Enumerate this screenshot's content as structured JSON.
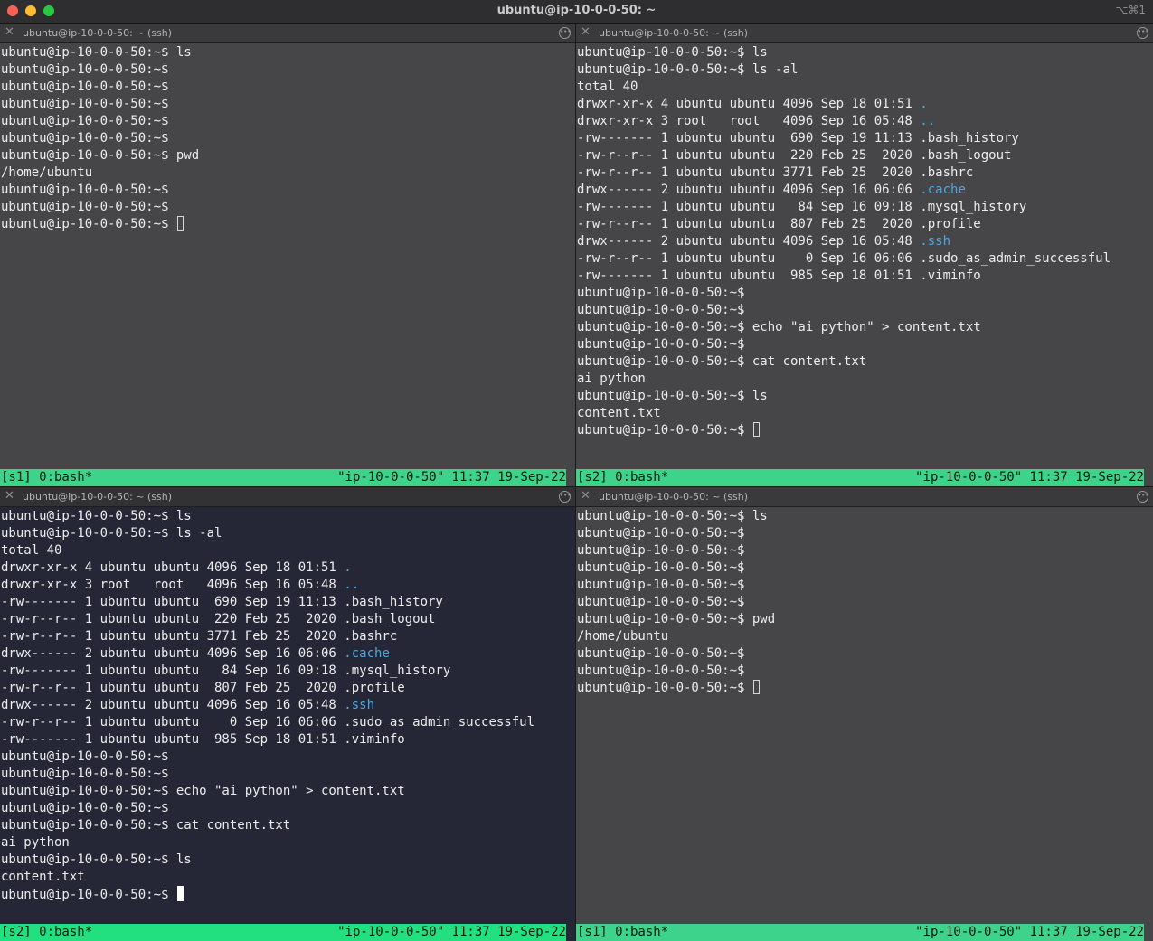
{
  "window": {
    "title": "ubuntu@ip-10-0-0-50: ~",
    "shortcut": "⌥⌘1"
  },
  "panes": [
    {
      "tab_title": "ubuntu@ip-10-0-0-50: ~ (ssh)",
      "active": false,
      "cursor": "box",
      "lines": [
        "ubuntu@ip-10-0-0-50:~$ ls",
        "ubuntu@ip-10-0-0-50:~$",
        "ubuntu@ip-10-0-0-50:~$",
        "ubuntu@ip-10-0-0-50:~$",
        "ubuntu@ip-10-0-0-50:~$",
        "ubuntu@ip-10-0-0-50:~$",
        "ubuntu@ip-10-0-0-50:~$ pwd",
        "/home/ubuntu",
        "ubuntu@ip-10-0-0-50:~$",
        "ubuntu@ip-10-0-0-50:~$",
        "ubuntu@ip-10-0-0-50:~$ "
      ],
      "status_left": "[s1] 0:bash*",
      "status_right": "\"ip-10-0-0-50\" 11:37 19-Sep-22"
    },
    {
      "tab_title": "ubuntu@ip-10-0-0-50: ~ (ssh)",
      "active": false,
      "cursor": "box",
      "lines": [
        "ubuntu@ip-10-0-0-50:~$ ls",
        "ubuntu@ip-10-0-0-50:~$ ls -al",
        "total 40",
        "drwxr-xr-x 4 ubuntu ubuntu 4096 Sep 18 01:51 |.",
        "drwxr-xr-x 3 root   root   4096 Sep 16 05:48 |..",
        "-rw------- 1 ubuntu ubuntu  690 Sep 19 11:13 .bash_history",
        "-rw-r--r-- 1 ubuntu ubuntu  220 Feb 25  2020 .bash_logout",
        "-rw-r--r-- 1 ubuntu ubuntu 3771 Feb 25  2020 .bashrc",
        "drwx------ 2 ubuntu ubuntu 4096 Sep 16 06:06 |.cache",
        "-rw------- 1 ubuntu ubuntu   84 Sep 16 09:18 .mysql_history",
        "-rw-r--r-- 1 ubuntu ubuntu  807 Feb 25  2020 .profile",
        "drwx------ 2 ubuntu ubuntu 4096 Sep 16 05:48 |.ssh",
        "-rw-r--r-- 1 ubuntu ubuntu    0 Sep 16 06:06 .sudo_as_admin_successful",
        "-rw------- 1 ubuntu ubuntu  985 Sep 18 01:51 .viminfo",
        "ubuntu@ip-10-0-0-50:~$",
        "ubuntu@ip-10-0-0-50:~$",
        "ubuntu@ip-10-0-0-50:~$ echo \"ai python\" > content.txt",
        "ubuntu@ip-10-0-0-50:~$",
        "ubuntu@ip-10-0-0-50:~$ cat content.txt",
        "ai python",
        "ubuntu@ip-10-0-0-50:~$ ls",
        "content.txt",
        "ubuntu@ip-10-0-0-50:~$ "
      ],
      "status_left": "[s2] 0:bash*",
      "status_right": "\"ip-10-0-0-50\" 11:37 19-Sep-22"
    },
    {
      "tab_title": "ubuntu@ip-10-0-0-50: ~ (ssh)",
      "active": true,
      "cursor": "block",
      "lines": [
        "ubuntu@ip-10-0-0-50:~$ ls",
        "ubuntu@ip-10-0-0-50:~$ ls -al",
        "total 40",
        "drwxr-xr-x 4 ubuntu ubuntu 4096 Sep 18 01:51 |.",
        "drwxr-xr-x 3 root   root   4096 Sep 16 05:48 |..",
        "-rw------- 1 ubuntu ubuntu  690 Sep 19 11:13 .bash_history",
        "-rw-r--r-- 1 ubuntu ubuntu  220 Feb 25  2020 .bash_logout",
        "-rw-r--r-- 1 ubuntu ubuntu 3771 Feb 25  2020 .bashrc",
        "drwx------ 2 ubuntu ubuntu 4096 Sep 16 06:06 |.cache",
        "-rw------- 1 ubuntu ubuntu   84 Sep 16 09:18 .mysql_history",
        "-rw-r--r-- 1 ubuntu ubuntu  807 Feb 25  2020 .profile",
        "drwx------ 2 ubuntu ubuntu 4096 Sep 16 05:48 |.ssh",
        "-rw-r--r-- 1 ubuntu ubuntu    0 Sep 16 06:06 .sudo_as_admin_successful",
        "-rw------- 1 ubuntu ubuntu  985 Sep 18 01:51 .viminfo",
        "ubuntu@ip-10-0-0-50:~$",
        "ubuntu@ip-10-0-0-50:~$",
        "ubuntu@ip-10-0-0-50:~$ echo \"ai python\" > content.txt",
        "ubuntu@ip-10-0-0-50:~$",
        "ubuntu@ip-10-0-0-50:~$ cat content.txt",
        "ai python",
        "ubuntu@ip-10-0-0-50:~$ ls",
        "content.txt",
        "ubuntu@ip-10-0-0-50:~$ "
      ],
      "status_left": "[s2] 0:bash*",
      "status_right": "\"ip-10-0-0-50\" 11:37 19-Sep-22"
    },
    {
      "tab_title": "ubuntu@ip-10-0-0-50: ~ (ssh)",
      "active": false,
      "cursor": "box",
      "lines": [
        "ubuntu@ip-10-0-0-50:~$ ls",
        "ubuntu@ip-10-0-0-50:~$",
        "ubuntu@ip-10-0-0-50:~$",
        "ubuntu@ip-10-0-0-50:~$",
        "ubuntu@ip-10-0-0-50:~$",
        "ubuntu@ip-10-0-0-50:~$",
        "ubuntu@ip-10-0-0-50:~$ pwd",
        "/home/ubuntu",
        "ubuntu@ip-10-0-0-50:~$",
        "ubuntu@ip-10-0-0-50:~$",
        "ubuntu@ip-10-0-0-50:~$ "
      ],
      "status_left": "[s1] 0:bash*",
      "status_right": "\"ip-10-0-0-50\" 11:37 19-Sep-22"
    }
  ]
}
